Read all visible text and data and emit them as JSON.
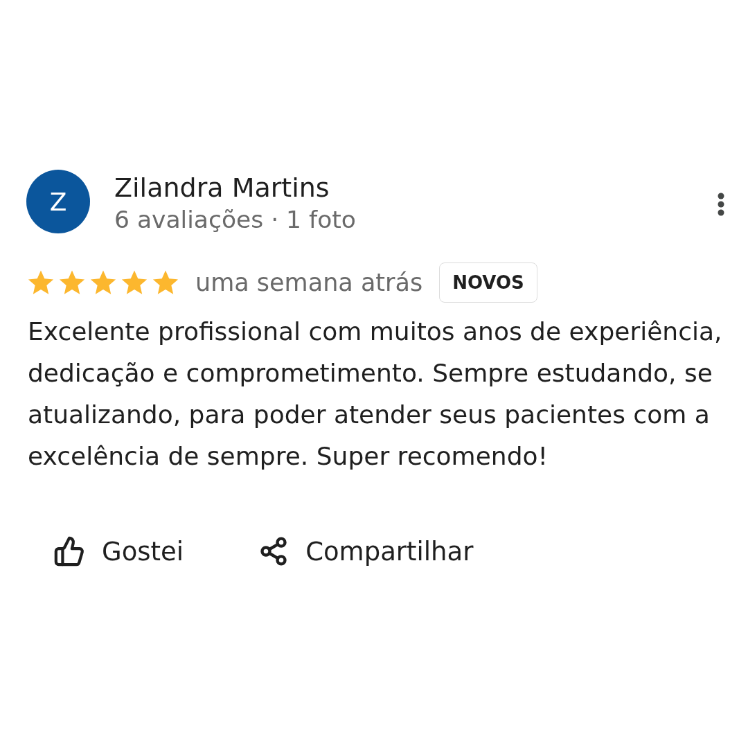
{
  "reviewer": {
    "avatar_letter": "Z",
    "name": "Zilandra Martins",
    "meta": "6 avaliações · 1 foto"
  },
  "rating": {
    "stars": 5,
    "time": "uma semana atrás",
    "badge": "NOVOS"
  },
  "review_text": "Excelente profissional com muitos anos de experiência, dedicação e comprometimento. Sempre estudando, se atualizando, para poder atender seus pacientes com a excelência de sempre. Super recomendo!",
  "actions": [
    {
      "kind": "like",
      "label": "Gostei"
    },
    {
      "kind": "share",
      "label": "Compartilhar"
    }
  ]
}
